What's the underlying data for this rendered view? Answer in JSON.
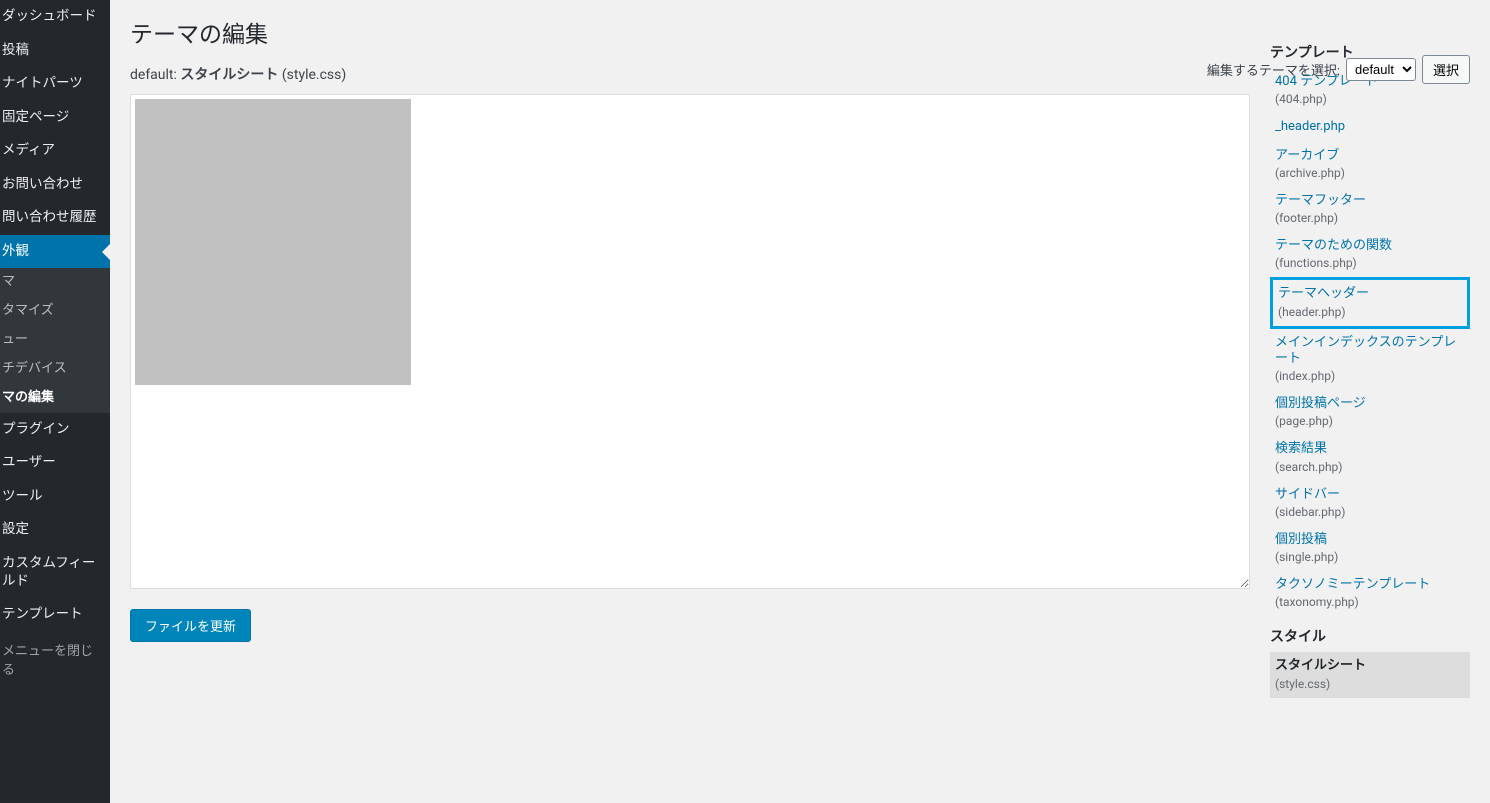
{
  "sidebar": {
    "items": [
      {
        "label": "ダッシュボード"
      },
      {
        "label": "投稿"
      },
      {
        "label": "ナイトパーツ"
      },
      {
        "label": "固定ページ"
      },
      {
        "label": "メディア"
      },
      {
        "label": "お問い合わせ"
      },
      {
        "label": "問い合わせ履歴"
      }
    ],
    "active": "外観",
    "submenu": [
      "マ",
      "タマイズ",
      "ュー",
      "チデバイス",
      "マの編集"
    ],
    "after": [
      "プラグイン",
      "ユーザー",
      "ツール",
      "設定",
      "カスタムフィールド",
      "テンプレート"
    ],
    "collapse": "メニューを閉じる"
  },
  "page": {
    "title": "テーマの編集",
    "file_prefix": "default: ",
    "file_bold": "スタイルシート",
    "file_suffix": " (style.css)"
  },
  "selector": {
    "label": "編集するテーマを選択:",
    "value": "default",
    "button": "選択"
  },
  "filelist": {
    "templates_heading": "テンプレート",
    "styles_heading": "スタイル",
    "templates": [
      {
        "title": "404 テンプレート",
        "file": "(404.php)"
      },
      {
        "title": "_header.php",
        "file": ""
      },
      {
        "title": "アーカイブ",
        "file": "(archive.php)"
      },
      {
        "title": "テーマフッター",
        "file": "(footer.php)"
      },
      {
        "title": "テーマのための関数",
        "file": "(functions.php)"
      },
      {
        "title": "テーマヘッダー",
        "file": "(header.php)"
      },
      {
        "title": "メインインデックスのテンプレート",
        "file": "(index.php)"
      },
      {
        "title": "個別投稿ページ",
        "file": "(page.php)"
      },
      {
        "title": "検索結果",
        "file": "(search.php)"
      },
      {
        "title": "サイドバー",
        "file": "(sidebar.php)"
      },
      {
        "title": "個別投稿",
        "file": "(single.php)"
      },
      {
        "title": "タクソノミーテンプレート",
        "file": "(taxonomy.php)"
      }
    ],
    "styles": [
      {
        "title": "スタイルシート",
        "file": "(style.css)"
      }
    ]
  },
  "button": {
    "update": "ファイルを更新"
  }
}
